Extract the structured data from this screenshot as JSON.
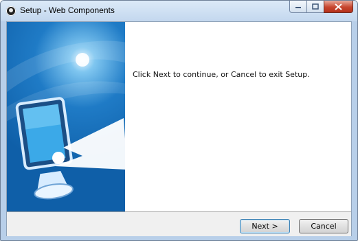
{
  "window": {
    "title": "Setup - Web Components",
    "icon": "app-icon",
    "controls": [
      "minimize-icon",
      "maximize-icon",
      "close-icon"
    ]
  },
  "main": {
    "message": "Click Next to continue, or Cancel to exit Setup."
  },
  "footer": {
    "next_label": "Next >",
    "cancel_label": "Cancel"
  },
  "colors": {
    "banner_blue": "#1f7bc6",
    "title_bar": "#c3d7ee",
    "close_red": "#c7462f"
  }
}
